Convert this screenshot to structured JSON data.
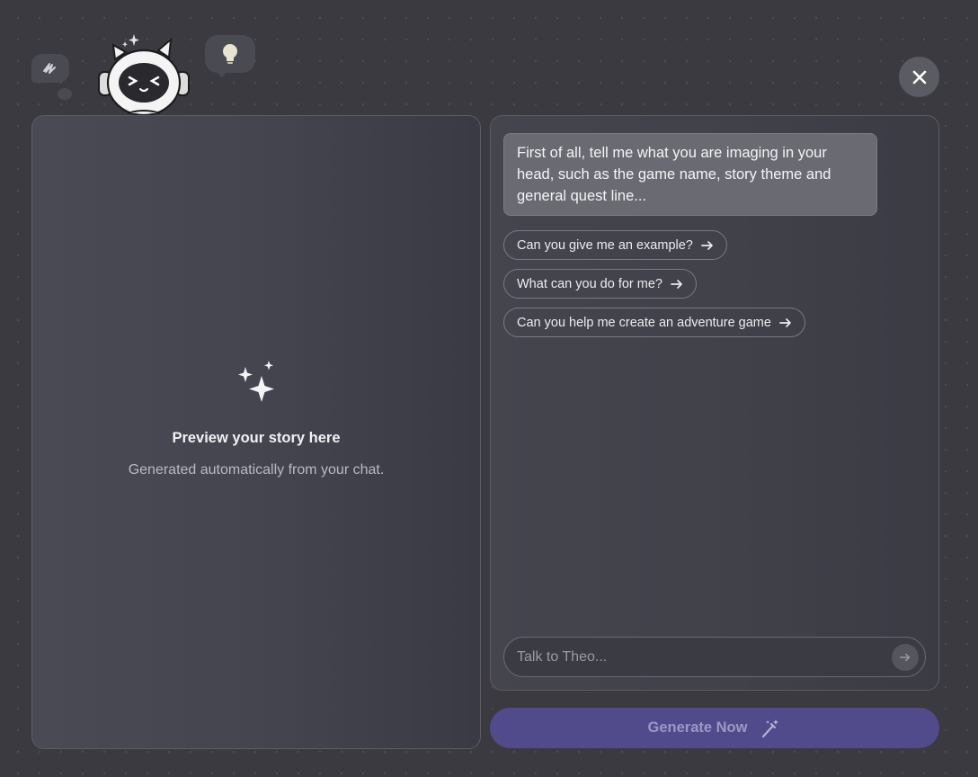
{
  "mascot": {
    "name_icon": "robot-cat-mascot-icon",
    "bubbles": [
      "scribble-icon",
      "lightbulb-icon"
    ]
  },
  "close_button": {
    "icon": "close-icon"
  },
  "preview": {
    "icon": "sparkles-icon",
    "title": "Preview your story here",
    "subtitle": "Generated automatically from your chat."
  },
  "chat": {
    "assistant_message": "First of all, tell me what you are imaging in your head, such as the game name, story theme and general quest line...",
    "suggestions": [
      {
        "label": "Can you give me an example?"
      },
      {
        "label": "What can you do for me?"
      },
      {
        "label": "Can you help me create an adventure game"
      }
    ],
    "input": {
      "placeholder": "Talk to Theo...",
      "value": ""
    }
  },
  "generate": {
    "label": "Generate Now",
    "icon": "magic-wand-icon"
  },
  "colors": {
    "background": "#3a3a40",
    "panel": "#45454f",
    "accent": "#514b8c",
    "accent_text": "#9c98c4"
  }
}
